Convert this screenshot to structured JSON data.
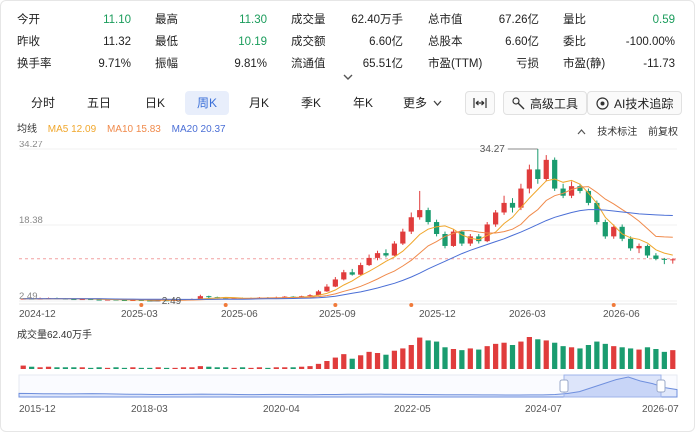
{
  "stats": {
    "rows": [
      [
        {
          "label": "今开",
          "value": "11.10",
          "color": "green"
        },
        {
          "label": "最高",
          "value": "11.30",
          "color": "green"
        },
        {
          "label": "成交量",
          "value": "62.40万手"
        },
        {
          "label": "总市值",
          "value": "67.26亿"
        },
        {
          "label": "量比",
          "value": "0.59",
          "color": "green"
        }
      ],
      [
        {
          "label": "昨收",
          "value": "11.32"
        },
        {
          "label": "最低",
          "value": "10.19",
          "color": "green"
        },
        {
          "label": "成交额",
          "value": "6.60亿"
        },
        {
          "label": "总股本",
          "value": "6.60亿"
        },
        {
          "label": "委比",
          "value": "-100.00%"
        }
      ],
      [
        {
          "label": "换手率",
          "value": "9.71%"
        },
        {
          "label": "振幅",
          "value": "9.81%"
        },
        {
          "label": "流通值",
          "value": "65.51亿"
        },
        {
          "label": "市盈(TTM)",
          "value": "亏损"
        },
        {
          "label": "市盈(静)",
          "value": "-11.73"
        }
      ]
    ]
  },
  "tabs": [
    {
      "label": "分时",
      "active": false
    },
    {
      "label": "五日",
      "active": false
    },
    {
      "label": "日K",
      "active": false
    },
    {
      "label": "周K",
      "active": true
    },
    {
      "label": "月K",
      "active": false
    },
    {
      "label": "季K",
      "active": false
    },
    {
      "label": "年K",
      "active": false
    },
    {
      "label": "更多",
      "active": false
    }
  ],
  "tools": {
    "advanced": "高级工具",
    "ai": "AI技术追踪"
  },
  "legend": {
    "label": "均线",
    "ma5": "MA5 12.09",
    "ma10": "MA10 15.83",
    "ma20": "MA20 20.37",
    "ma5_color": "#f0a72c",
    "ma10_color": "#f08a4b",
    "ma20_color": "#4b6fd6"
  },
  "chart_links": {
    "tech": "技术标注",
    "adjust": "前复权"
  },
  "volume_label": "成交量62.40万手",
  "colors": {
    "up": "#e03c3c",
    "down": "#1a9c6f",
    "accent": "#3a6fd8"
  },
  "chart_data": {
    "type": "candlestick",
    "x_labels": [
      "2024-12",
      "2025-03",
      "2025-06",
      "2025-09",
      "2025-12",
      "2026-03",
      "2026-06"
    ],
    "y_ticks": [
      "34.27",
      "18.38",
      "2.49"
    ],
    "ylim": [
      2.49,
      34.27
    ],
    "annotations": {
      "high": "34.27",
      "low": "2.49"
    },
    "reference_price": 11.32,
    "candles": [
      [
        2.9,
        3.0,
        3.1,
        2.8
      ],
      [
        3.0,
        2.9,
        3.1,
        2.8
      ],
      [
        2.9,
        3.0,
        3.2,
        2.8
      ],
      [
        3.0,
        3.1,
        3.2,
        2.9
      ],
      [
        3.1,
        3.0,
        3.2,
        2.9
      ],
      [
        3.0,
        2.9,
        3.1,
        2.8
      ],
      [
        2.9,
        2.8,
        3.0,
        2.7
      ],
      [
        2.8,
        2.9,
        3.0,
        2.7
      ],
      [
        2.9,
        2.8,
        3.0,
        2.7
      ],
      [
        2.8,
        2.7,
        2.9,
        2.6
      ],
      [
        2.7,
        2.8,
        2.9,
        2.6
      ],
      [
        2.8,
        2.7,
        2.9,
        2.6
      ],
      [
        2.7,
        2.6,
        2.8,
        2.5
      ],
      [
        2.6,
        2.7,
        2.8,
        2.5
      ],
      [
        2.7,
        2.6,
        2.8,
        2.5
      ],
      [
        2.6,
        2.55,
        2.7,
        2.49
      ],
      [
        2.55,
        2.65,
        2.7,
        2.5
      ],
      [
        2.65,
        2.6,
        2.7,
        2.5
      ],
      [
        2.6,
        2.7,
        2.8,
        2.5
      ],
      [
        2.7,
        2.8,
        2.9,
        2.6
      ],
      [
        2.8,
        2.9,
        3.0,
        2.7
      ],
      [
        2.9,
        3.5,
        3.8,
        2.8
      ],
      [
        3.5,
        3.3,
        3.6,
        3.1
      ],
      [
        3.3,
        3.1,
        3.4,
        3.0
      ],
      [
        3.1,
        3.0,
        3.2,
        2.9
      ],
      [
        3.0,
        3.1,
        3.2,
        2.9
      ],
      [
        3.1,
        3.0,
        3.2,
        2.9
      ],
      [
        3.0,
        3.1,
        3.2,
        2.9
      ],
      [
        3.1,
        3.2,
        3.3,
        3.0
      ],
      [
        3.2,
        3.1,
        3.3,
        3.0
      ],
      [
        3.1,
        3.2,
        3.4,
        3.0
      ],
      [
        3.2,
        3.4,
        3.5,
        3.1
      ],
      [
        3.4,
        3.3,
        3.5,
        3.2
      ],
      [
        3.3,
        3.5,
        3.6,
        3.2
      ],
      [
        3.5,
        3.7,
        3.9,
        3.4
      ],
      [
        3.7,
        4.5,
        4.8,
        3.6
      ],
      [
        4.5,
        5.5,
        6.0,
        4.4
      ],
      [
        5.5,
        7.0,
        7.5,
        5.4
      ],
      [
        7.0,
        8.5,
        9.0,
        6.8
      ],
      [
        8.5,
        8.0,
        9.2,
        7.8
      ],
      [
        8.0,
        10.0,
        10.5,
        7.9
      ],
      [
        10.0,
        11.5,
        12.2,
        9.8
      ],
      [
        11.5,
        12.5,
        13.0,
        11.0
      ],
      [
        12.5,
        12.0,
        13.3,
        11.6
      ],
      [
        12.0,
        14.5,
        15.0,
        11.9
      ],
      [
        14.5,
        17.0,
        17.6,
        14.2
      ],
      [
        17.0,
        20.0,
        21.0,
        16.5
      ],
      [
        20.0,
        21.5,
        25.5,
        19.5
      ],
      [
        21.5,
        19.0,
        22.0,
        18.5
      ],
      [
        19.0,
        16.5,
        19.5,
        16.0
      ],
      [
        16.5,
        14.0,
        17.0,
        13.5
      ],
      [
        14.0,
        17.0,
        17.5,
        13.8
      ],
      [
        17.0,
        14.5,
        17.3,
        14.0
      ],
      [
        14.5,
        16.0,
        16.5,
        14.0
      ],
      [
        16.0,
        15.0,
        16.5,
        14.5
      ],
      [
        15.0,
        18.5,
        19.0,
        14.8
      ],
      [
        18.5,
        21.0,
        21.5,
        18.0
      ],
      [
        21.0,
        23.0,
        24.5,
        20.5
      ],
      [
        23.0,
        22.0,
        24.0,
        21.0
      ],
      [
        22.0,
        26.0,
        27.0,
        21.5
      ],
      [
        26.0,
        30.0,
        31.0,
        25.0
      ],
      [
        30.0,
        28.0,
        34.27,
        27.0
      ],
      [
        28.0,
        32.0,
        33.0,
        27.5
      ],
      [
        32.0,
        26.0,
        32.5,
        25.5
      ],
      [
        26.0,
        24.5,
        27.0,
        24.0
      ],
      [
        24.5,
        26.5,
        27.5,
        24.0
      ],
      [
        26.5,
        25.5,
        27.0,
        25.0
      ],
      [
        25.5,
        23.0,
        26.0,
        22.5
      ],
      [
        23.0,
        19.0,
        23.5,
        18.5
      ],
      [
        19.0,
        16.0,
        19.5,
        15.5
      ],
      [
        16.0,
        18.0,
        18.5,
        15.5
      ],
      [
        18.0,
        15.5,
        18.5,
        15.0
      ],
      [
        15.5,
        13.5,
        16.0,
        13.0
      ],
      [
        13.5,
        14.0,
        14.5,
        12.5
      ],
      [
        14.0,
        12.0,
        14.3,
        11.5
      ],
      [
        12.0,
        11.3,
        12.5,
        11.0
      ],
      [
        11.3,
        11.1,
        11.5,
        10.2
      ],
      [
        11.1,
        11.2,
        11.4,
        10.3
      ]
    ],
    "volumes": [
      6,
      4,
      3,
      4,
      3,
      3,
      3,
      3,
      2,
      3,
      2,
      3,
      2,
      3,
      2,
      2,
      3,
      2,
      2,
      3,
      3,
      5,
      4,
      3,
      3,
      2,
      3,
      2,
      3,
      2,
      3,
      3,
      3,
      4,
      5,
      9,
      14,
      20,
      26,
      18,
      24,
      30,
      28,
      25,
      32,
      36,
      42,
      55,
      50,
      48,
      38,
      35,
      33,
      36,
      34,
      40,
      44,
      46,
      42,
      48,
      56,
      52,
      50,
      46,
      40,
      38,
      36,
      42,
      48,
      44,
      40,
      38,
      36,
      34,
      38,
      35,
      30,
      33
    ],
    "volume_max": 56,
    "sma": {
      "ma5": [
        2.95,
        2.96,
        2.97,
        2.98,
        3.0,
        3.0,
        2.98,
        2.94,
        2.9,
        2.84,
        2.8,
        2.78,
        2.74,
        2.72,
        2.7,
        2.66,
        2.63,
        2.62,
        2.63,
        2.67,
        2.72,
        2.9,
        3.02,
        3.12,
        3.24,
        3.2,
        3.1,
        3.06,
        3.08,
        3.12,
        3.12,
        3.16,
        3.24,
        3.3,
        3.42,
        3.68,
        4.08,
        4.8,
        5.84,
        6.7,
        7.8,
        8.7,
        9.7,
        10.8,
        11.7,
        12.9,
        14.6,
        16.4,
        17.5,
        18.0,
        18.2,
        17.5,
        16.3,
        15.6,
        15.3,
        16.2,
        16.9,
        18.7,
        20.0,
        22.0,
        24.0,
        25.8,
        27.6,
        28.0,
        27.3,
        27.7,
        26.9,
        25.1,
        22.9,
        20.0,
        18.3,
        16.5,
        15.7,
        15.4,
        14.6,
        13.2,
        12.5,
        12.09
      ],
      "ma10": [
        2.95,
        2.95,
        2.96,
        2.96,
        2.97,
        2.97,
        2.97,
        2.97,
        2.96,
        2.94,
        2.9,
        2.87,
        2.84,
        2.81,
        2.77,
        2.74,
        2.71,
        2.7,
        2.68,
        2.68,
        2.69,
        2.76,
        2.82,
        2.87,
        2.97,
        2.96,
        2.98,
        3.02,
        3.06,
        3.13,
        3.16,
        3.18,
        3.15,
        3.18,
        3.26,
        3.42,
        3.61,
        3.98,
        4.51,
        4.97,
        5.57,
        6.3,
        7.1,
        7.98,
        8.74,
        9.8,
        11.0,
        12.5,
        14.0,
        14.9,
        16.0,
        16.6,
        17.2,
        17.2,
        16.9,
        16.7,
        16.7,
        17.0,
        17.5,
        18.5,
        20.3,
        21.6,
        23.5,
        24.5,
        25.0,
        25.8,
        26.3,
        26.4,
        25.2,
        23.8,
        22.8,
        21.6,
        20.5,
        19.2,
        17.6,
        16.0,
        15.9,
        15.83
      ],
      "ma20": [
        2.95,
        2.95,
        2.95,
        2.95,
        2.95,
        2.95,
        2.95,
        2.95,
        2.95,
        2.95,
        2.93,
        2.91,
        2.89,
        2.88,
        2.87,
        2.86,
        2.85,
        2.84,
        2.83,
        2.82,
        2.82,
        2.82,
        2.83,
        2.84,
        2.87,
        2.87,
        2.87,
        2.89,
        2.92,
        2.95,
        2.98,
        3.0,
        3.02,
        3.05,
        3.1,
        3.18,
        3.3,
        3.5,
        3.8,
        4.1,
        4.4,
        4.8,
        5.2,
        5.7,
        6.2,
        6.8,
        7.5,
        8.3,
        9.2,
        10.0,
        10.8,
        11.6,
        12.4,
        13.1,
        13.7,
        14.3,
        14.9,
        15.5,
        16.2,
        16.9,
        17.7,
        18.5,
        19.3,
        20.0,
        20.5,
        21.0,
        21.4,
        21.6,
        21.6,
        21.5,
        21.3,
        21.1,
        20.9,
        20.7,
        20.6,
        20.5,
        20.4,
        20.37
      ]
    },
    "markers": [
      14,
      24,
      37,
      46,
      70
    ],
    "nav_labels": [
      "2015-12",
      "2018-03",
      "2020-04",
      "2022-05",
      "2024-07",
      "2026-07"
    ],
    "nav_series": [
      5.2,
      5.0,
      4.8,
      4.6,
      4.5,
      4.7,
      4.9,
      4.6,
      4.3,
      4.0,
      3.8,
      3.6,
      3.5,
      3.7,
      3.9,
      4.2,
      4.0,
      3.8,
      3.6,
      3.4,
      3.5,
      3.7,
      3.6,
      3.4,
      3.3,
      3.5,
      3.6,
      3.8,
      3.9,
      4.1,
      4.0,
      3.8,
      3.7,
      3.5,
      3.4,
      3.3,
      3.2,
      3.1,
      3.0,
      2.9,
      2.8,
      2.8,
      2.9,
      3.0,
      3.5,
      5.0,
      8.0,
      14.0,
      20.0,
      26.0,
      30.0,
      24.0,
      20.0,
      14.0,
      11.0
    ]
  }
}
